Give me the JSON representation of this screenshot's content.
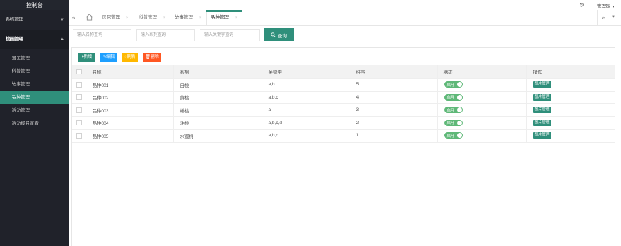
{
  "sidebar": {
    "brand": "控制台",
    "groups": [
      {
        "label": "系统管理",
        "caret": "▼"
      },
      {
        "label": "桃园管理",
        "caret": "▲"
      }
    ],
    "items": [
      "园区管理",
      "科普管理",
      "故事管理",
      "品种管理",
      "活动管理",
      "活动报名查看"
    ]
  },
  "header": {
    "refresh_icon": "↻",
    "user_label": "管理员",
    "user_caret": "▼"
  },
  "tabs": {
    "left_arrow": "«",
    "right_arrow": "»",
    "dropdown_caret": "▼",
    "close_glyph": "×",
    "items": [
      "园区管理",
      "科普管理",
      "故事管理",
      "品种管理"
    ]
  },
  "search": {
    "name_placeholder": "输入名称查询",
    "series_placeholder": "输入系列查询",
    "keyword_placeholder": "输入关键字查询",
    "query_label": "查询"
  },
  "toolbar": {
    "add_label": "+新增",
    "edit_label": "✎编辑",
    "refresh_label": "◌刷新",
    "delete_label": "🗑删除"
  },
  "table": {
    "headers": [
      "名称",
      "系列",
      "关键字",
      "排序",
      "状态",
      "操作"
    ],
    "rows": [
      {
        "name": "品种001",
        "series": "白桃",
        "keywords": "a,b",
        "sort": "5",
        "status": "启用",
        "action": "图片管理"
      },
      {
        "name": "品种002",
        "series": "黄桃",
        "keywords": "a,b,c",
        "sort": "4",
        "status": "启用",
        "action": "图片管理"
      },
      {
        "name": "品种003",
        "series": "蟠桃",
        "keywords": "a",
        "sort": "3",
        "status": "启用",
        "action": "图片管理"
      },
      {
        "name": "品种004",
        "series": "油桃",
        "keywords": "a,b,c,d",
        "sort": "2",
        "status": "启用",
        "action": "图片管理"
      },
      {
        "name": "品种005",
        "series": "水蜜桃",
        "keywords": "a,b,c",
        "sort": "1",
        "status": "启用",
        "action": "图片管理"
      }
    ]
  },
  "colors": {
    "sidebar_bg": "#20222a",
    "accent": "#2f8f7b",
    "add_btn": "#2f8f7b",
    "edit_btn": "#1e9fff",
    "refresh_btn": "#ffb800",
    "delete_btn": "#ff5722",
    "switch_on": "#5fb878"
  }
}
